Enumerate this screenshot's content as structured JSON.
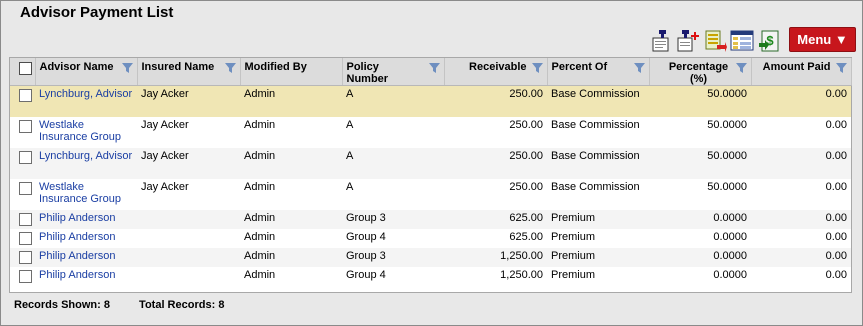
{
  "page": {
    "title": "Advisor Payment List"
  },
  "toolbar": {
    "menu_label": "Menu ▼",
    "icons": [
      "pin-document-icon",
      "pin-add-icon",
      "export-excel-icon",
      "column-layout-icon",
      "payment-icon"
    ]
  },
  "table": {
    "headers": [
      {
        "label": "",
        "filter": false
      },
      {
        "label": "Advisor Name",
        "filter": true
      },
      {
        "label": "Insured Name",
        "filter": true
      },
      {
        "label": "Modified By",
        "filter": false
      },
      {
        "label": "Policy Number",
        "filter": true
      },
      {
        "label": "Receivable",
        "filter": true
      },
      {
        "label": "Percent Of",
        "filter": true
      },
      {
        "label": "Percentage (%)",
        "filter": true
      },
      {
        "label": "Amount Paid",
        "filter": true
      }
    ],
    "rows": [
      {
        "advisor": "Lynchburg, Advisor",
        "insured": "Jay Acker",
        "modified_by": "Admin",
        "policy": "A",
        "receivable": "250.00",
        "percent_of": "Base Commission",
        "percentage": "50.0000",
        "amount_paid": "0.00"
      },
      {
        "advisor": "Westlake Insurance Group",
        "insured": "Jay Acker",
        "modified_by": "Admin",
        "policy": "A",
        "receivable": "250.00",
        "percent_of": "Base Commission",
        "percentage": "50.0000",
        "amount_paid": "0.00"
      },
      {
        "advisor": "Lynchburg, Advisor",
        "insured": "Jay Acker",
        "modified_by": "Admin",
        "policy": "A",
        "receivable": "250.00",
        "percent_of": "Base Commission",
        "percentage": "50.0000",
        "amount_paid": "0.00"
      },
      {
        "advisor": "Westlake Insurance Group",
        "insured": "Jay Acker",
        "modified_by": "Admin",
        "policy": "A",
        "receivable": "250.00",
        "percent_of": "Base Commission",
        "percentage": "50.0000",
        "amount_paid": "0.00"
      },
      {
        "advisor": "Philip Anderson",
        "insured": "",
        "modified_by": "Admin",
        "policy": "Group 3",
        "receivable": "625.00",
        "percent_of": "Premium",
        "percentage": "0.0000",
        "amount_paid": "0.00"
      },
      {
        "advisor": "Philip Anderson",
        "insured": "",
        "modified_by": "Admin",
        "policy": "Group 4",
        "receivable": "625.00",
        "percent_of": "Premium",
        "percentage": "0.0000",
        "amount_paid": "0.00"
      },
      {
        "advisor": "Philip Anderson",
        "insured": "",
        "modified_by": "Admin",
        "policy": "Group 3",
        "receivable": "1,250.00",
        "percent_of": "Premium",
        "percentage": "0.0000",
        "amount_paid": "0.00"
      },
      {
        "advisor": "Philip Anderson",
        "insured": "",
        "modified_by": "Admin",
        "policy": "Group 4",
        "receivable": "1,250.00",
        "percent_of": "Premium",
        "percentage": "0.0000",
        "amount_paid": "0.00"
      }
    ]
  },
  "footer": {
    "records_shown_label": "Records Shown:",
    "records_shown": "8",
    "total_records_label": "Total Records:",
    "total_records": "8"
  },
  "colors": {
    "menu": "#c7161c",
    "highlight_row": "#f0e6b4",
    "link": "#1a3ea3"
  }
}
